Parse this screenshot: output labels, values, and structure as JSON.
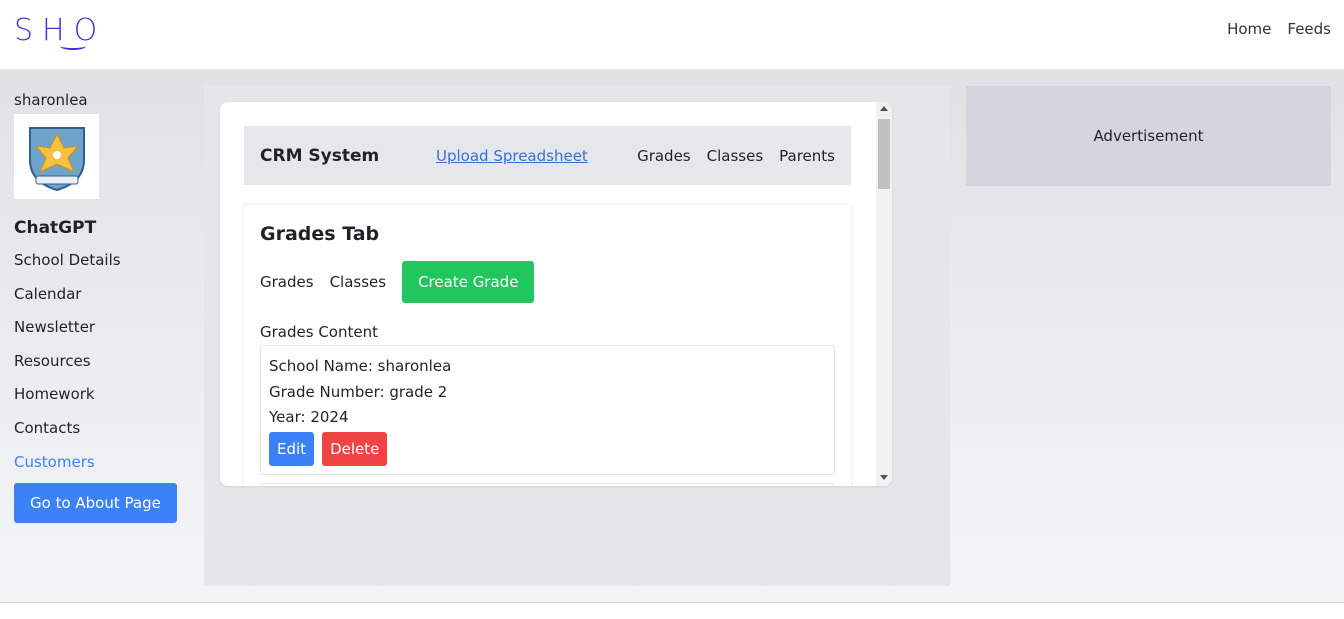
{
  "header": {
    "logo_text": "SHO",
    "nav": [
      "Home",
      "Feeds"
    ]
  },
  "sidebar": {
    "username": "sharonlea",
    "logo_icon": "school-crest-icon",
    "heading": "ChatGPT",
    "links": [
      {
        "label": "School Details"
      },
      {
        "label": "Calendar"
      },
      {
        "label": "Newsletter"
      },
      {
        "label": "Resources"
      },
      {
        "label": "Homework"
      },
      {
        "label": "Contacts"
      },
      {
        "label": "Customers"
      }
    ],
    "active_link": "Customers",
    "about_button": "Go to About Page"
  },
  "crm": {
    "title": "CRM System",
    "upload_link": "Upload Spreadsheet",
    "nav": [
      "Grades",
      "Classes",
      "Parents"
    ]
  },
  "grades_tab": {
    "title": "Grades Tab",
    "tabs": [
      "Grades",
      "Classes"
    ],
    "create_button": "Create Grade",
    "content_label": "Grades Content",
    "items": [
      {
        "school_name": "School Name: sharonlea",
        "grade_number": "Grade Number: grade 2",
        "year": "Year: 2024",
        "edit_label": "Edit",
        "delete_label": "Delete"
      }
    ]
  },
  "advertisement": {
    "label": "Advertisement"
  },
  "colors": {
    "brand": "#4b2fd6",
    "primary": "#3b82f6",
    "success": "#22c55e",
    "danger": "#ef4444"
  }
}
